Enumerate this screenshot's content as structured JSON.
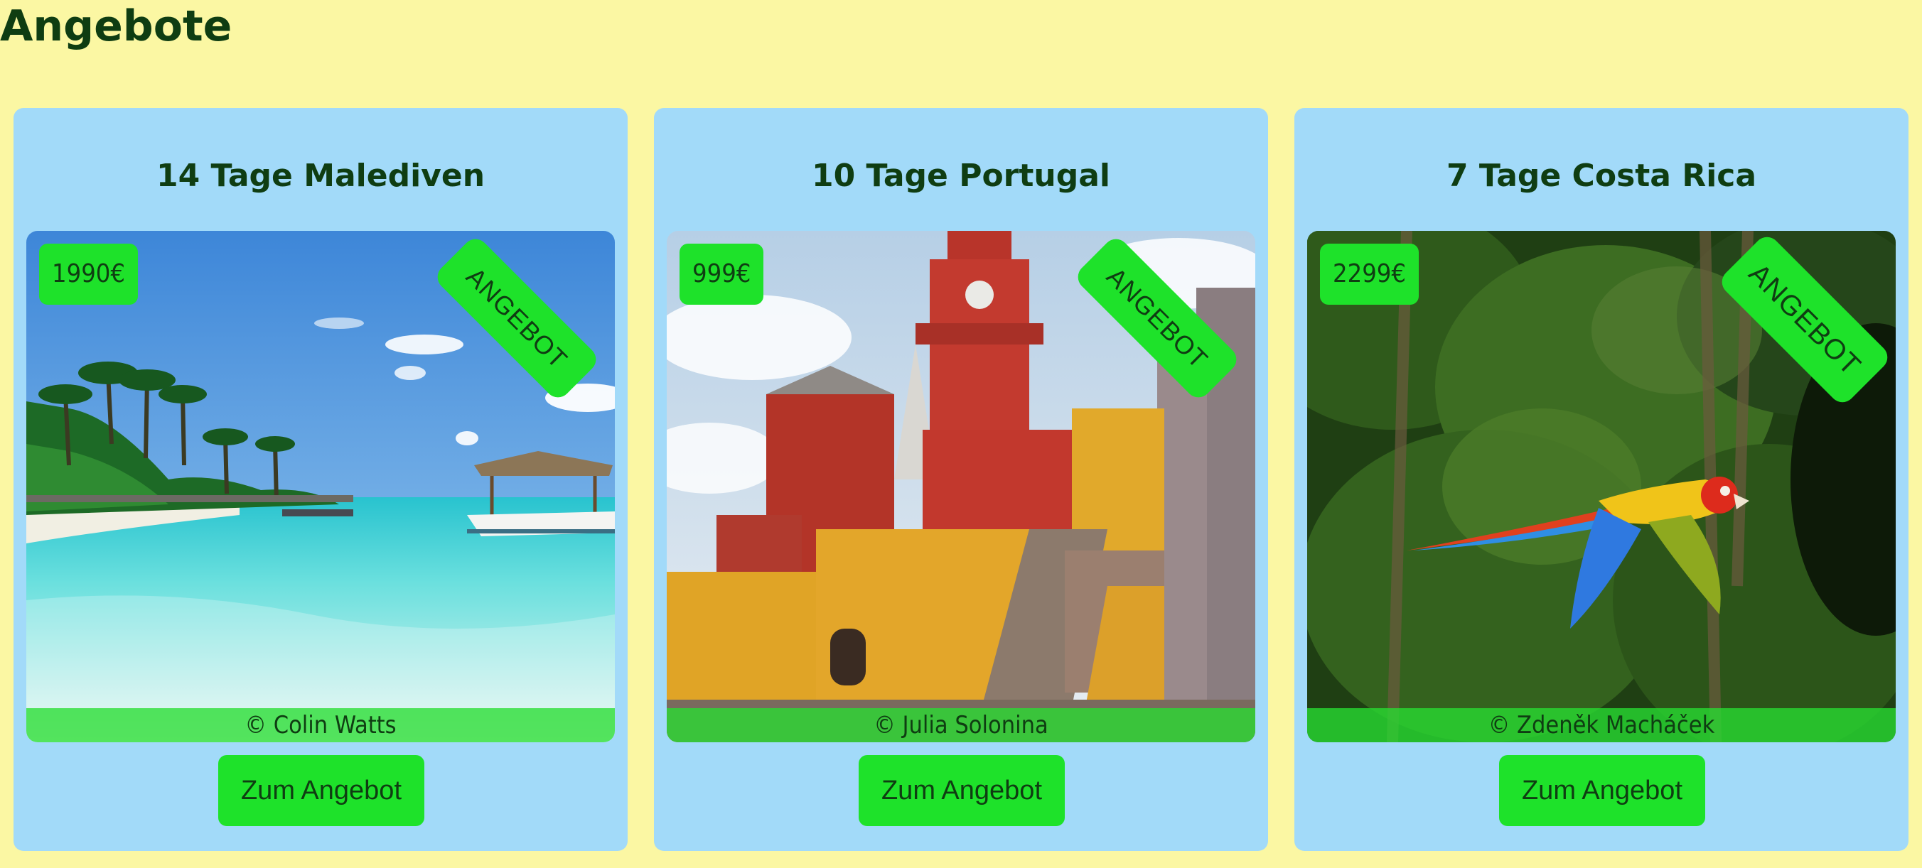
{
  "page": {
    "title": "Angebote"
  },
  "offers": [
    {
      "title": "14 Tage Malediven",
      "price": "1990€",
      "ribbon": "ANGEBOT",
      "credit": "© Colin Watts",
      "button_label": "Zum Angebot",
      "image": "maldives-beach-photo"
    },
    {
      "title": "10 Tage Portugal",
      "price": "999€",
      "ribbon": "ANGEBOT",
      "credit": "© Julia Solonina",
      "button_label": "Zum Angebot",
      "image": "pena-palace-photo"
    },
    {
      "title": "7 Tage Costa Rica",
      "price": "2299€",
      "ribbon": "ANGEBOT",
      "credit": "© Zdeněk Macháček",
      "button_label": "Zum Angebot",
      "image": "scarlet-macaw-photo"
    }
  ],
  "colors": {
    "background": "#fbf7a3",
    "card": "#a2daf9",
    "accent_green": "#1ee22a",
    "text_dark_green": "#0f3d12"
  }
}
